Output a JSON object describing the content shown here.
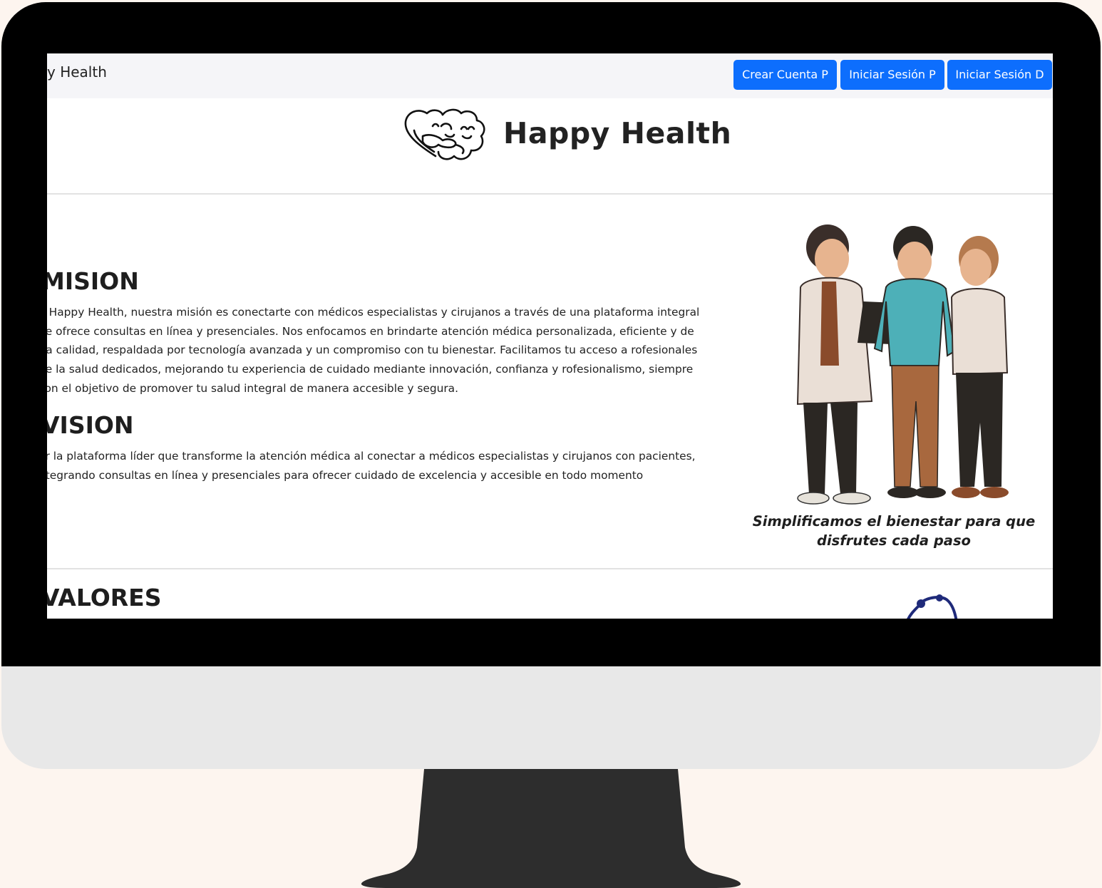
{
  "navbar": {
    "brand": "y Health",
    "buttons": [
      "Crear Cuenta P",
      "Iniciar Sesión P",
      "Iniciar Sesión D"
    ]
  },
  "header": {
    "title": "Happy Health",
    "logo_icon": "heart-brain-hug-logo"
  },
  "mision": {
    "heading": "MISION",
    "text": "n Happy Health, nuestra misión es conectarte con médicos especialistas y cirujanos a través de una plataforma integral ue ofrece consultas en línea y presenciales. Nos enfocamos en brindarte atención médica personalizada, eficiente y de lta calidad, respaldada por tecnología avanzada y un compromiso con tu bienestar. Facilitamos tu acceso a rofesionales de la salud dedicados, mejorando tu experiencia de cuidado mediante innovación, confianza y rofesionalismo, siempre con el objetivo de promover tu salud integral de manera accesible y segura."
  },
  "vision": {
    "heading": "VISION",
    "text": "er la plataforma líder que transforme la atención médica al conectar a médicos especialistas y cirujanos con pacientes, ntegrando consultas en línea y presenciales para ofrecer cuidado de excelencia y accesible en todo momento"
  },
  "illustration": {
    "icon": "doctor-patient-illustration",
    "caption": "Simplificamos el bienestar para que disfrutes cada paso"
  },
  "valores": {
    "heading": "VALORES",
    "icon": "stethoscope-icon"
  },
  "colors": {
    "accent": "#0d6efd",
    "bezel": "#000000",
    "background": "#fdf5ef",
    "monitor_chin": "#e8e8e8",
    "stand": "#2d2d2d"
  }
}
